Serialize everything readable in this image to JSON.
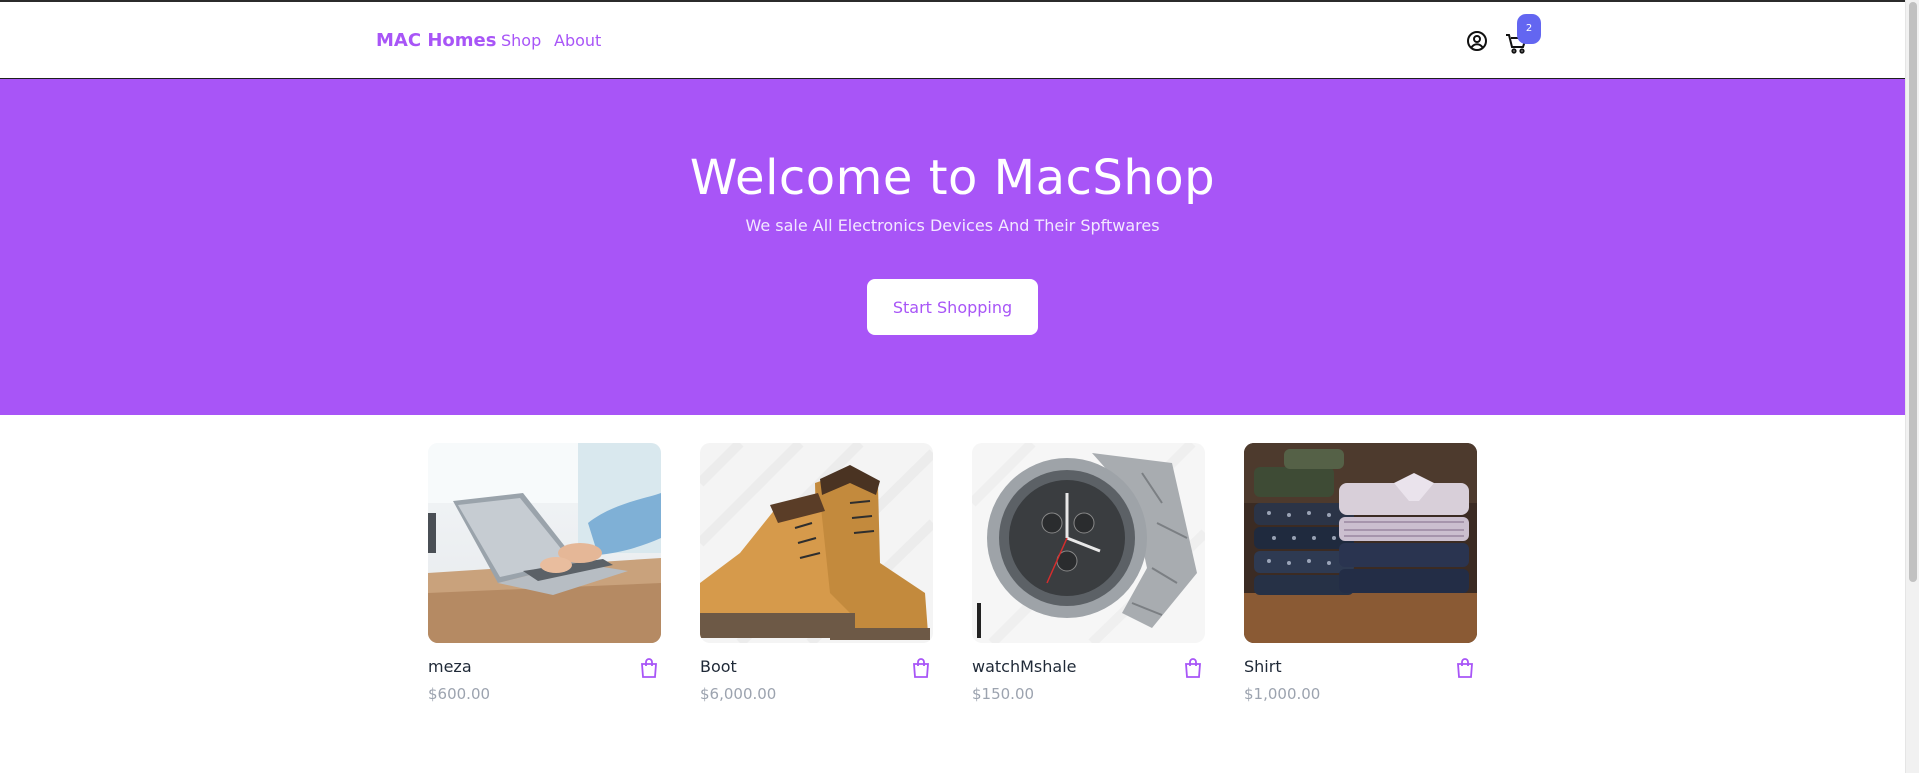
{
  "navbar": {
    "brand": "MAC Homes",
    "links": [
      "Shop",
      "About"
    ],
    "cart_count": "2",
    "icons": [
      "user-circle-icon",
      "cart-icon"
    ]
  },
  "hero": {
    "title": "Welcome to MacShop",
    "subtitle": "We sale All Electronics Devices And Their Spftwares",
    "button_label": "Start Shopping",
    "background_color": "#a855f7"
  },
  "products": [
    {
      "name": "meza",
      "price": "$600.00",
      "image": "laptop-photo"
    },
    {
      "name": "Boot",
      "price": "$6,000.00",
      "image": "boots-photo"
    },
    {
      "name": "watchMshale",
      "price": "$150.00",
      "image": "watch-photo"
    },
    {
      "name": "Shirt",
      "price": "$1,000.00",
      "image": "shirts-photo"
    }
  ],
  "colors": {
    "accent": "#a855f7",
    "badge": "#6366f1",
    "price": "#9ca3af"
  }
}
